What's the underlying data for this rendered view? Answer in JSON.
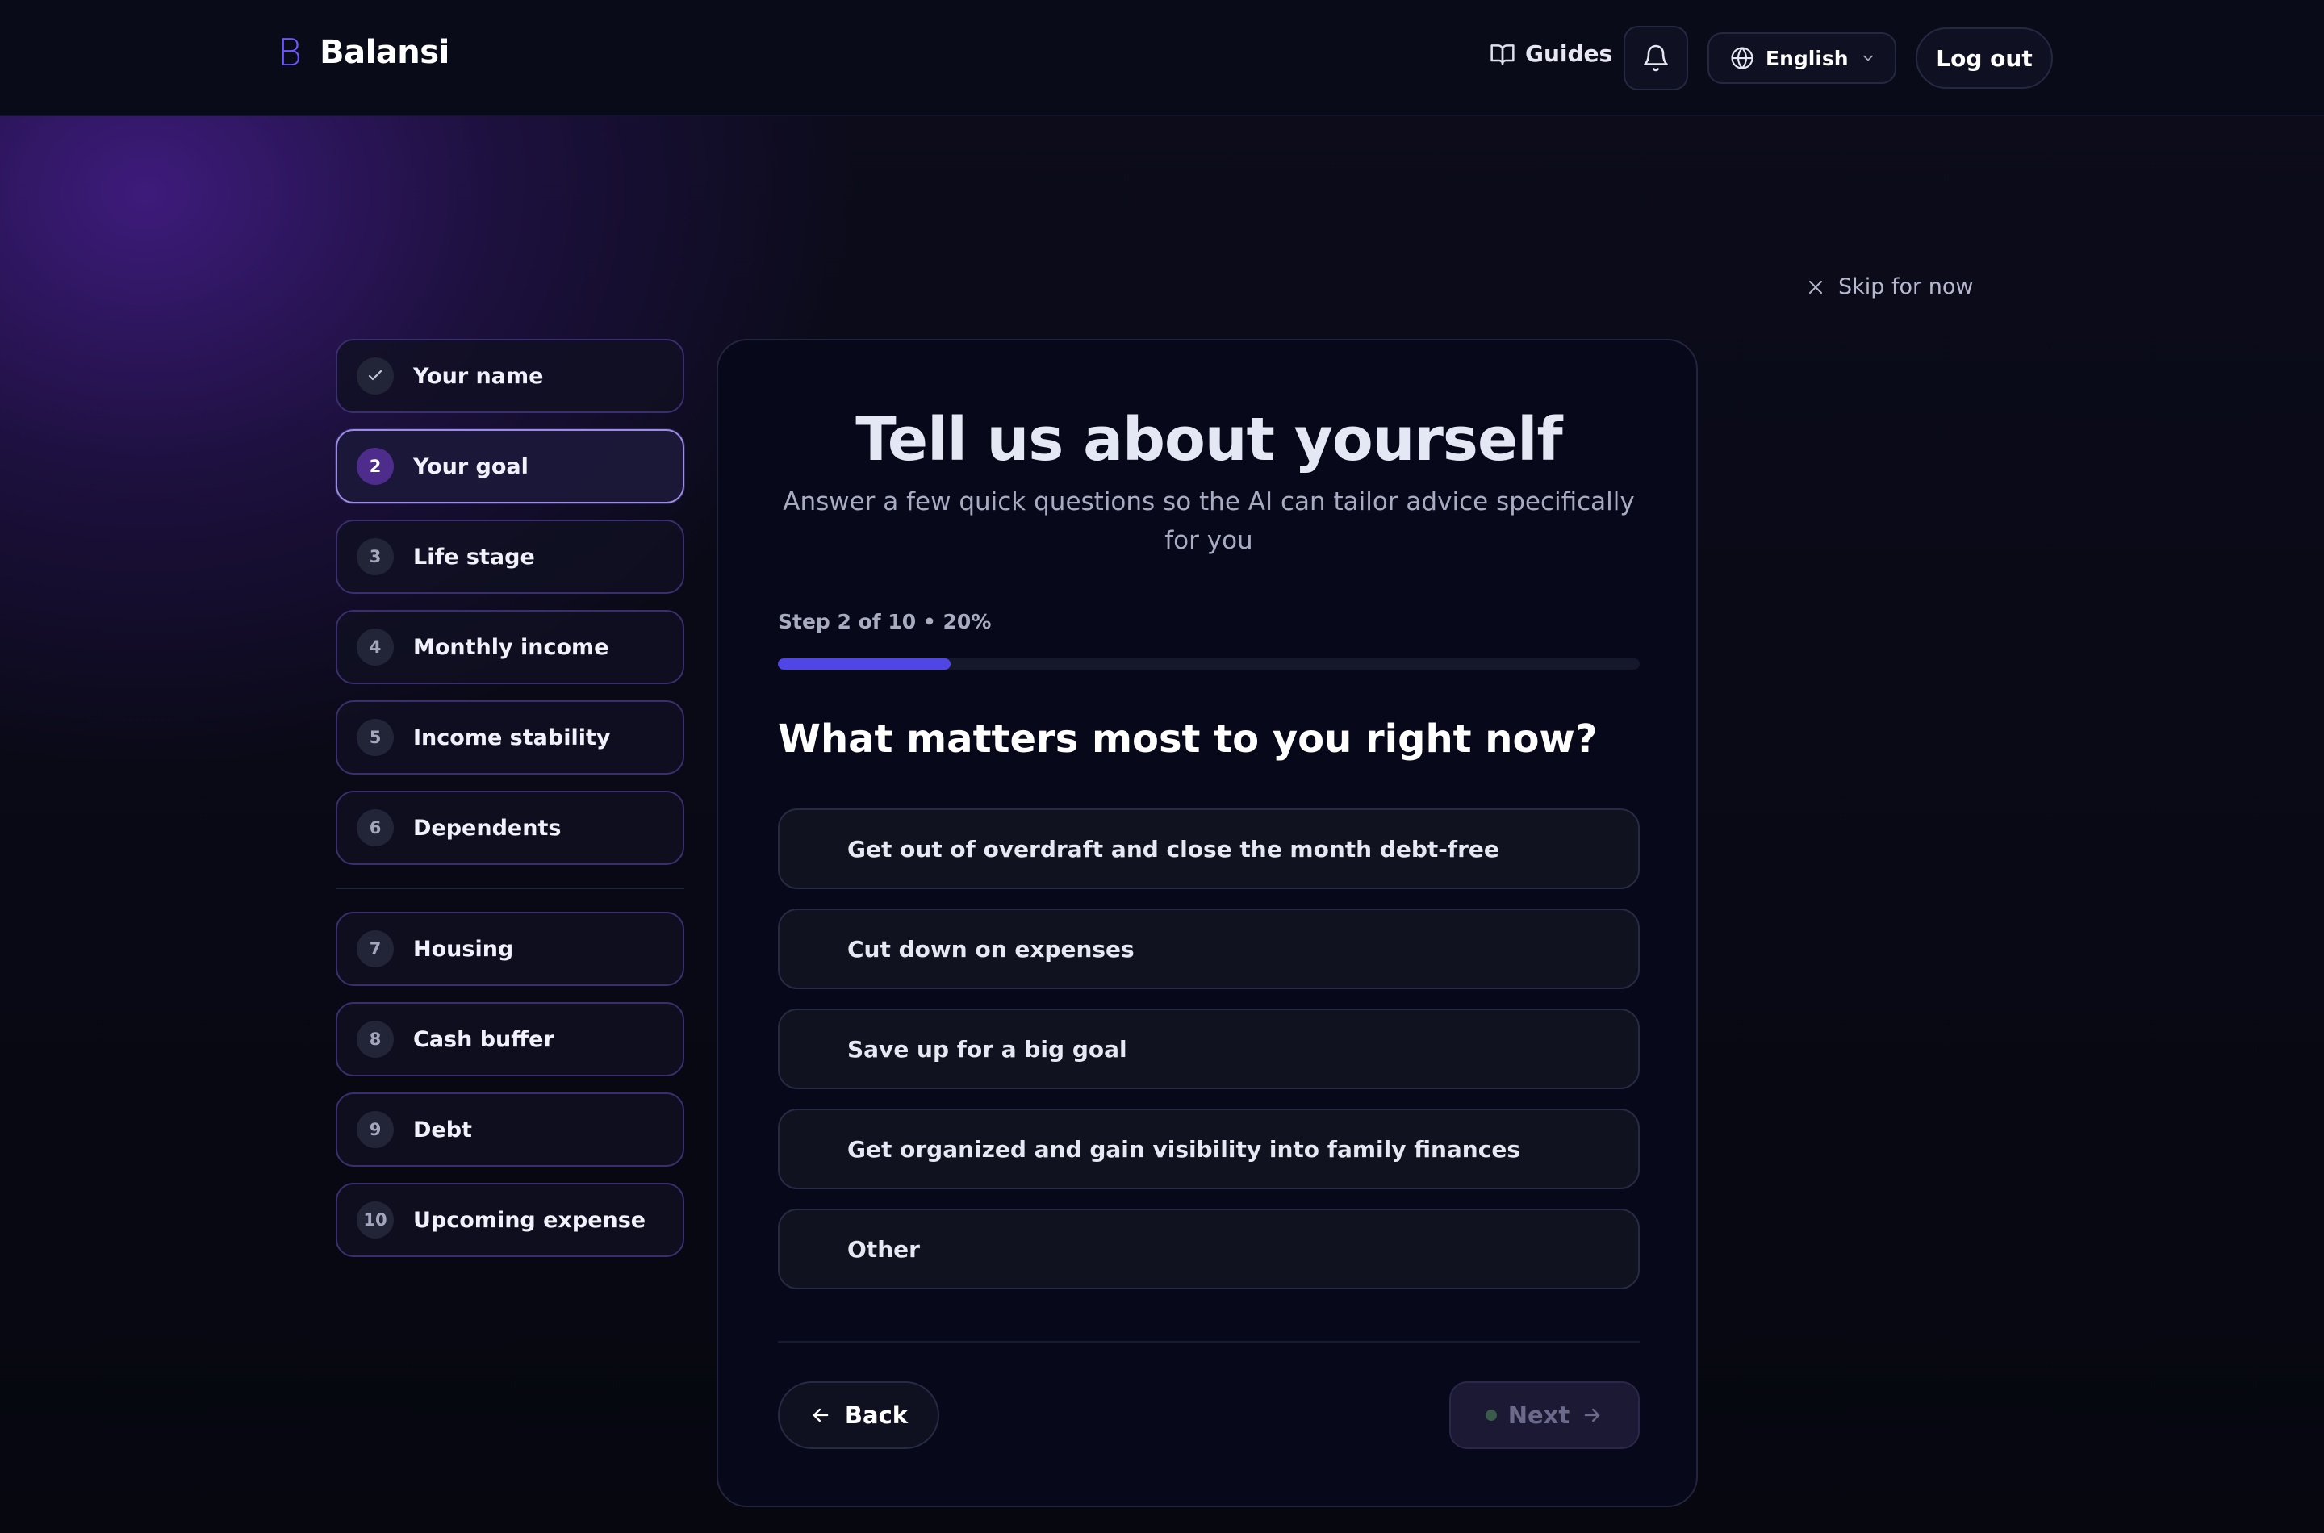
{
  "header": {
    "brand_mark": "B",
    "brand_name": "Balansi",
    "guides_label": "Guides",
    "language": "English",
    "logout_label": "Log out"
  },
  "skip_label": "Skip for now",
  "steps": [
    {
      "num": "✓",
      "label": "Your name",
      "state": "completed"
    },
    {
      "num": "2",
      "label": "Your goal",
      "state": "active"
    },
    {
      "num": "3",
      "label": "Life stage",
      "state": "pending"
    },
    {
      "num": "4",
      "label": "Monthly income",
      "state": "pending"
    },
    {
      "num": "5",
      "label": "Income stability",
      "state": "pending"
    },
    {
      "num": "6",
      "label": "Dependents",
      "state": "pending"
    },
    {
      "num": "7",
      "label": "Housing",
      "state": "pending"
    },
    {
      "num": "8",
      "label": "Cash buffer",
      "state": "pending"
    },
    {
      "num": "9",
      "label": "Debt",
      "state": "pending"
    },
    {
      "num": "10",
      "label": "Upcoming expense",
      "state": "pending"
    }
  ],
  "card": {
    "title": "Tell us about yourself",
    "subtitle": "Answer a few quick questions so the AI can tailor advice specifically for you",
    "progress_label": "Step 2 of 10 • 20%",
    "progress_fraction": 0.2,
    "question": "What matters most to you right now?",
    "options": [
      "Get out of overdraft and close the month debt-free",
      "Cut down on expenses",
      "Save up for a big goal",
      "Get organized and gain visibility into family finances",
      "Other"
    ],
    "back_label": "Back",
    "next_label": "Next"
  },
  "colors": {
    "accent": "#4f46e5",
    "brand": "#6a55ff",
    "background": "#05060f"
  }
}
